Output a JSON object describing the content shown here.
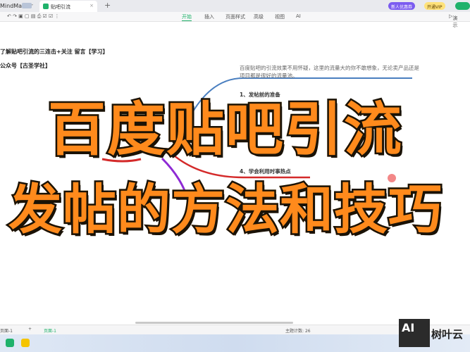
{
  "app": {
    "name": "MindMaster",
    "tab_title": "贴吧引流",
    "promo": "新人优惠券",
    "vip": "开通VIP"
  },
  "menu": [
    "开始",
    "插入",
    "页面样式",
    "高级",
    "视图",
    "AI"
  ],
  "toolbar": {
    "slideshow": "演示"
  },
  "canvas": {
    "note1": "了解贴吧引流的三连击+关注 留言【学习】",
    "note2": "公众号【古圣学社】",
    "desc": "百度贴吧的引流效果不用怀疑，这里的流量大的你不敢想象，无论卖产品还是项目都是很好的流量池。",
    "node1": "1、发帖前的准备",
    "node4": "4、学会利用时事热点"
  },
  "overlay": {
    "title_line1": "百度贴吧引流",
    "title_line2": "发帖的方法和技巧"
  },
  "statusbar": {
    "page_tab": "页面-1",
    "page_link": "页面-1",
    "topic_count_label": "主题计数:",
    "topic_count": "26"
  },
  "watermark": {
    "logo": "AI",
    "text": "树叶云"
  }
}
